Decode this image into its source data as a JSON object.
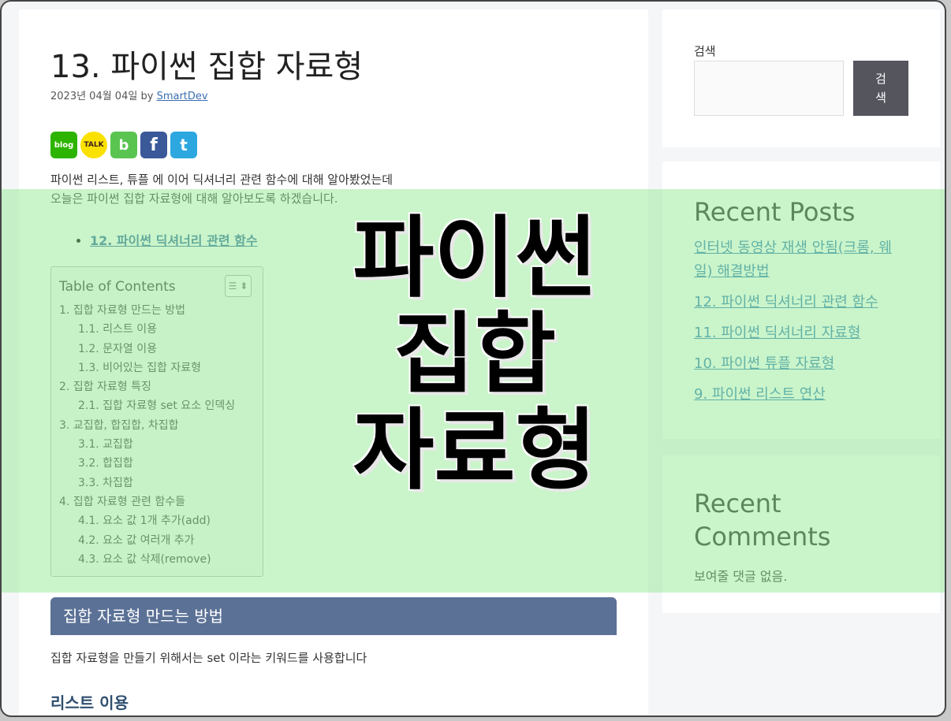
{
  "article": {
    "title": "13. 파이썬 집합 자료형",
    "date": "2023년 04월 04일",
    "by": "by",
    "author": "SmartDev",
    "share_icons": [
      {
        "label": "blog",
        "color": "#2db400"
      },
      {
        "label": "TALK",
        "color": "#fae100"
      },
      {
        "label": "b",
        "color": "#5ac451"
      },
      {
        "label": "f",
        "color": "#3b5998"
      },
      {
        "label": "t",
        "color": "#2ca7e0"
      }
    ],
    "intro_line1": "파이썬 리스트, 튜플 에 이어 딕셔너리 관련 함수에 대해 알아봤었는데",
    "intro_line2": "오늘은 파이썬 집합 자료형에 대해 알아보도록 하겠습니다.",
    "related_link": "12. 파이썬 딕셔너리 관련 함수",
    "section_heading": "집합 자료형 만드는 방법",
    "section_text": "집합 자료형을 만들기 위해서는 set 이라는 키워드를 사용합니다",
    "subheading": "리스트 이용"
  },
  "toc": {
    "title": "Table of Contents",
    "toggle_icon": "list-toggle-icon",
    "items": [
      {
        "text": "1. 집합 자료형 만드는 방법",
        "level": 1
      },
      {
        "text": "1.1. 리스트 이용",
        "level": 2
      },
      {
        "text": "1.2. 문자열 이용",
        "level": 2
      },
      {
        "text": "1.3. 비어있는 집합 자료형",
        "level": 2
      },
      {
        "text": "2. 집합 자료형 특징",
        "level": 1
      },
      {
        "text": "2.1. 집합 자료형 set 요소 인덱싱",
        "level": 2
      },
      {
        "text": "3. 교집합, 합집합, 차집합",
        "level": 1
      },
      {
        "text": "3.1. 교집합",
        "level": 2
      },
      {
        "text": "3.2. 합집합",
        "level": 2
      },
      {
        "text": "3.3. 차집합",
        "level": 2
      },
      {
        "text": "4. 집합 자료형 관련 함수들",
        "level": 1
      },
      {
        "text": "4.1. 요소 값 1개 추가(add)",
        "level": 2
      },
      {
        "text": "4.2. 요소 값 여러개 추가",
        "level": 2
      },
      {
        "text": "4.3. 요소 값 삭제(remove)",
        "level": 2
      }
    ]
  },
  "sidebar": {
    "search_label": "검색",
    "search_placeholder": "",
    "search_button": "검색",
    "recent_posts_title": "Recent Posts",
    "recent_posts": [
      "인터넷 동영상 재생 안됨(크롬, 웨일) 해결방법",
      "12. 파이썬 딕셔너리 관련 함수",
      "11. 파이썬 딕셔너리 자료형",
      "10. 파이썬 튜플 자료형",
      "9. 파이썬 리스트 연산"
    ],
    "recent_comments_title": "Recent Comments",
    "recent_comments_text": "보여줄 댓글 없음."
  },
  "overlay": {
    "lines": [
      "파이썬",
      "집합",
      "자료형"
    ],
    "color": "#96ea96"
  }
}
